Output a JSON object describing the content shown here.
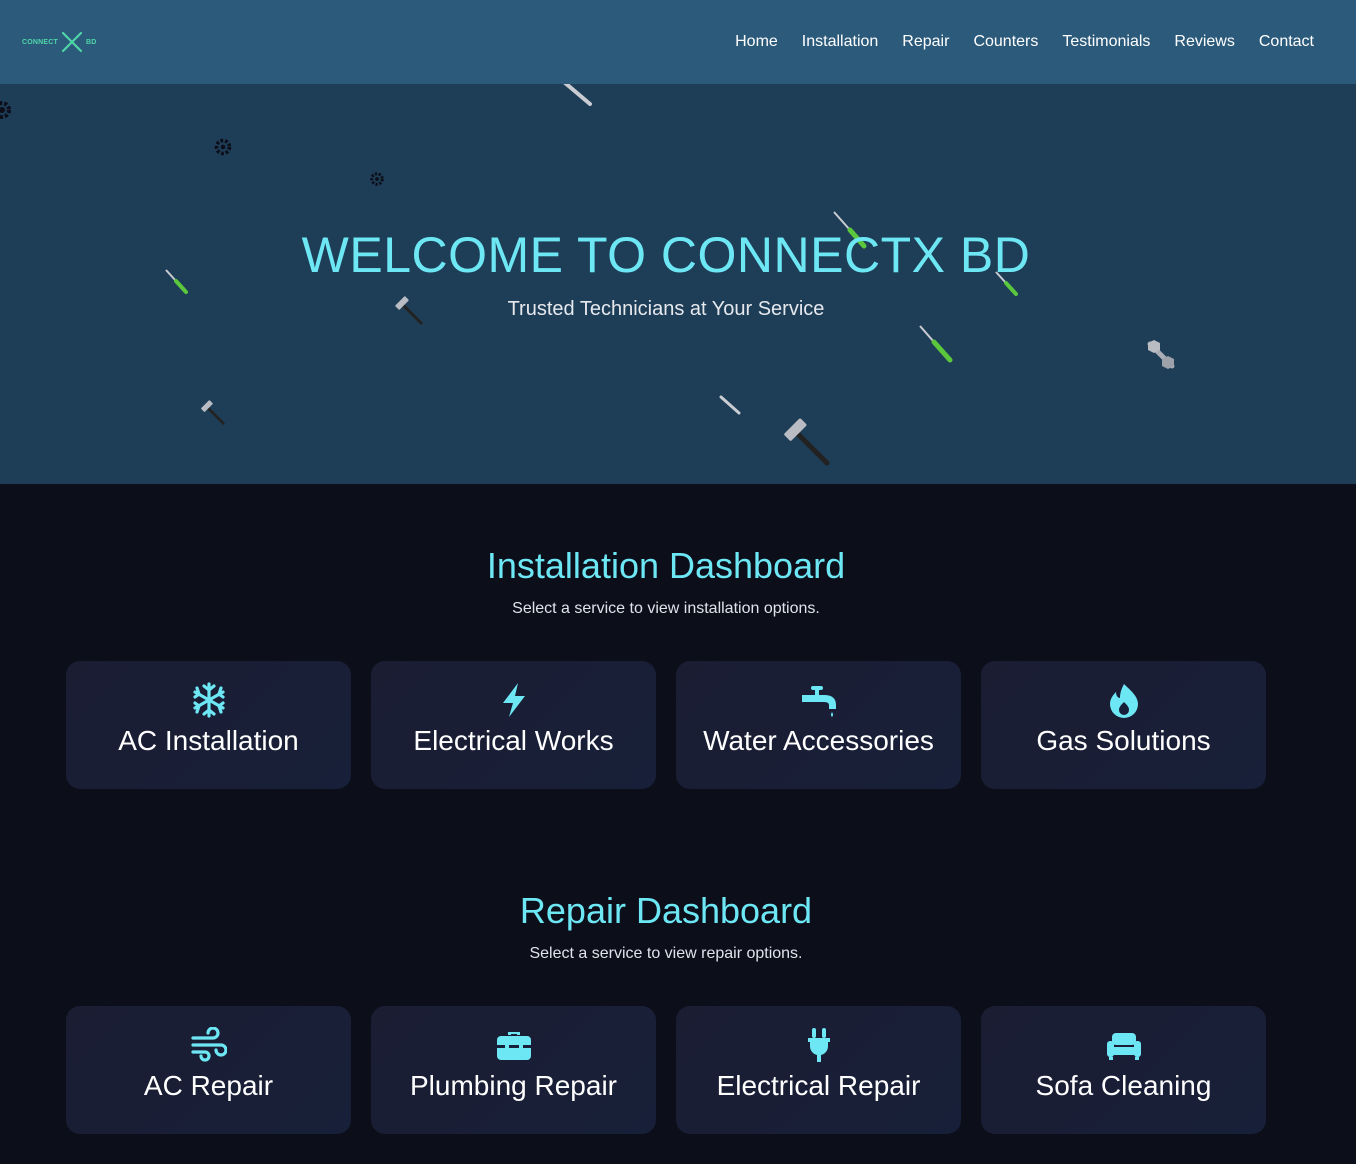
{
  "header": {
    "logo_left": "CONNECT",
    "logo_right": "BD",
    "nav": [
      "Home",
      "Installation",
      "Repair",
      "Counters",
      "Testimonials",
      "Reviews",
      "Contact"
    ]
  },
  "hero": {
    "title": "WELCOME TO CONNECTX BD",
    "subtitle": "Trusted Technicians at Your Service"
  },
  "installation": {
    "title": "Installation Dashboard",
    "subtitle": "Select a service to view installation options.",
    "cards": [
      {
        "label": "AC Installation",
        "icon": "snowflake-icon"
      },
      {
        "label": "Electrical Works",
        "icon": "bolt-icon"
      },
      {
        "label": "Water Accessories",
        "icon": "faucet-icon"
      },
      {
        "label": "Gas Solutions",
        "icon": "fire-icon"
      }
    ]
  },
  "repair": {
    "title": "Repair Dashboard",
    "subtitle": "Select a service to view repair options.",
    "cards": [
      {
        "label": "AC Repair",
        "icon": "wind-icon"
      },
      {
        "label": "Plumbing Repair",
        "icon": "toolbox-icon"
      },
      {
        "label": "Electrical Repair",
        "icon": "plug-icon"
      },
      {
        "label": "Sofa Cleaning",
        "icon": "couch-icon"
      }
    ]
  },
  "colors": {
    "header_bg": "#2c5a7b",
    "hero_bg": "#1e3d56",
    "page_bg": "#0c0e1a",
    "accent": "#6ee7f5"
  }
}
